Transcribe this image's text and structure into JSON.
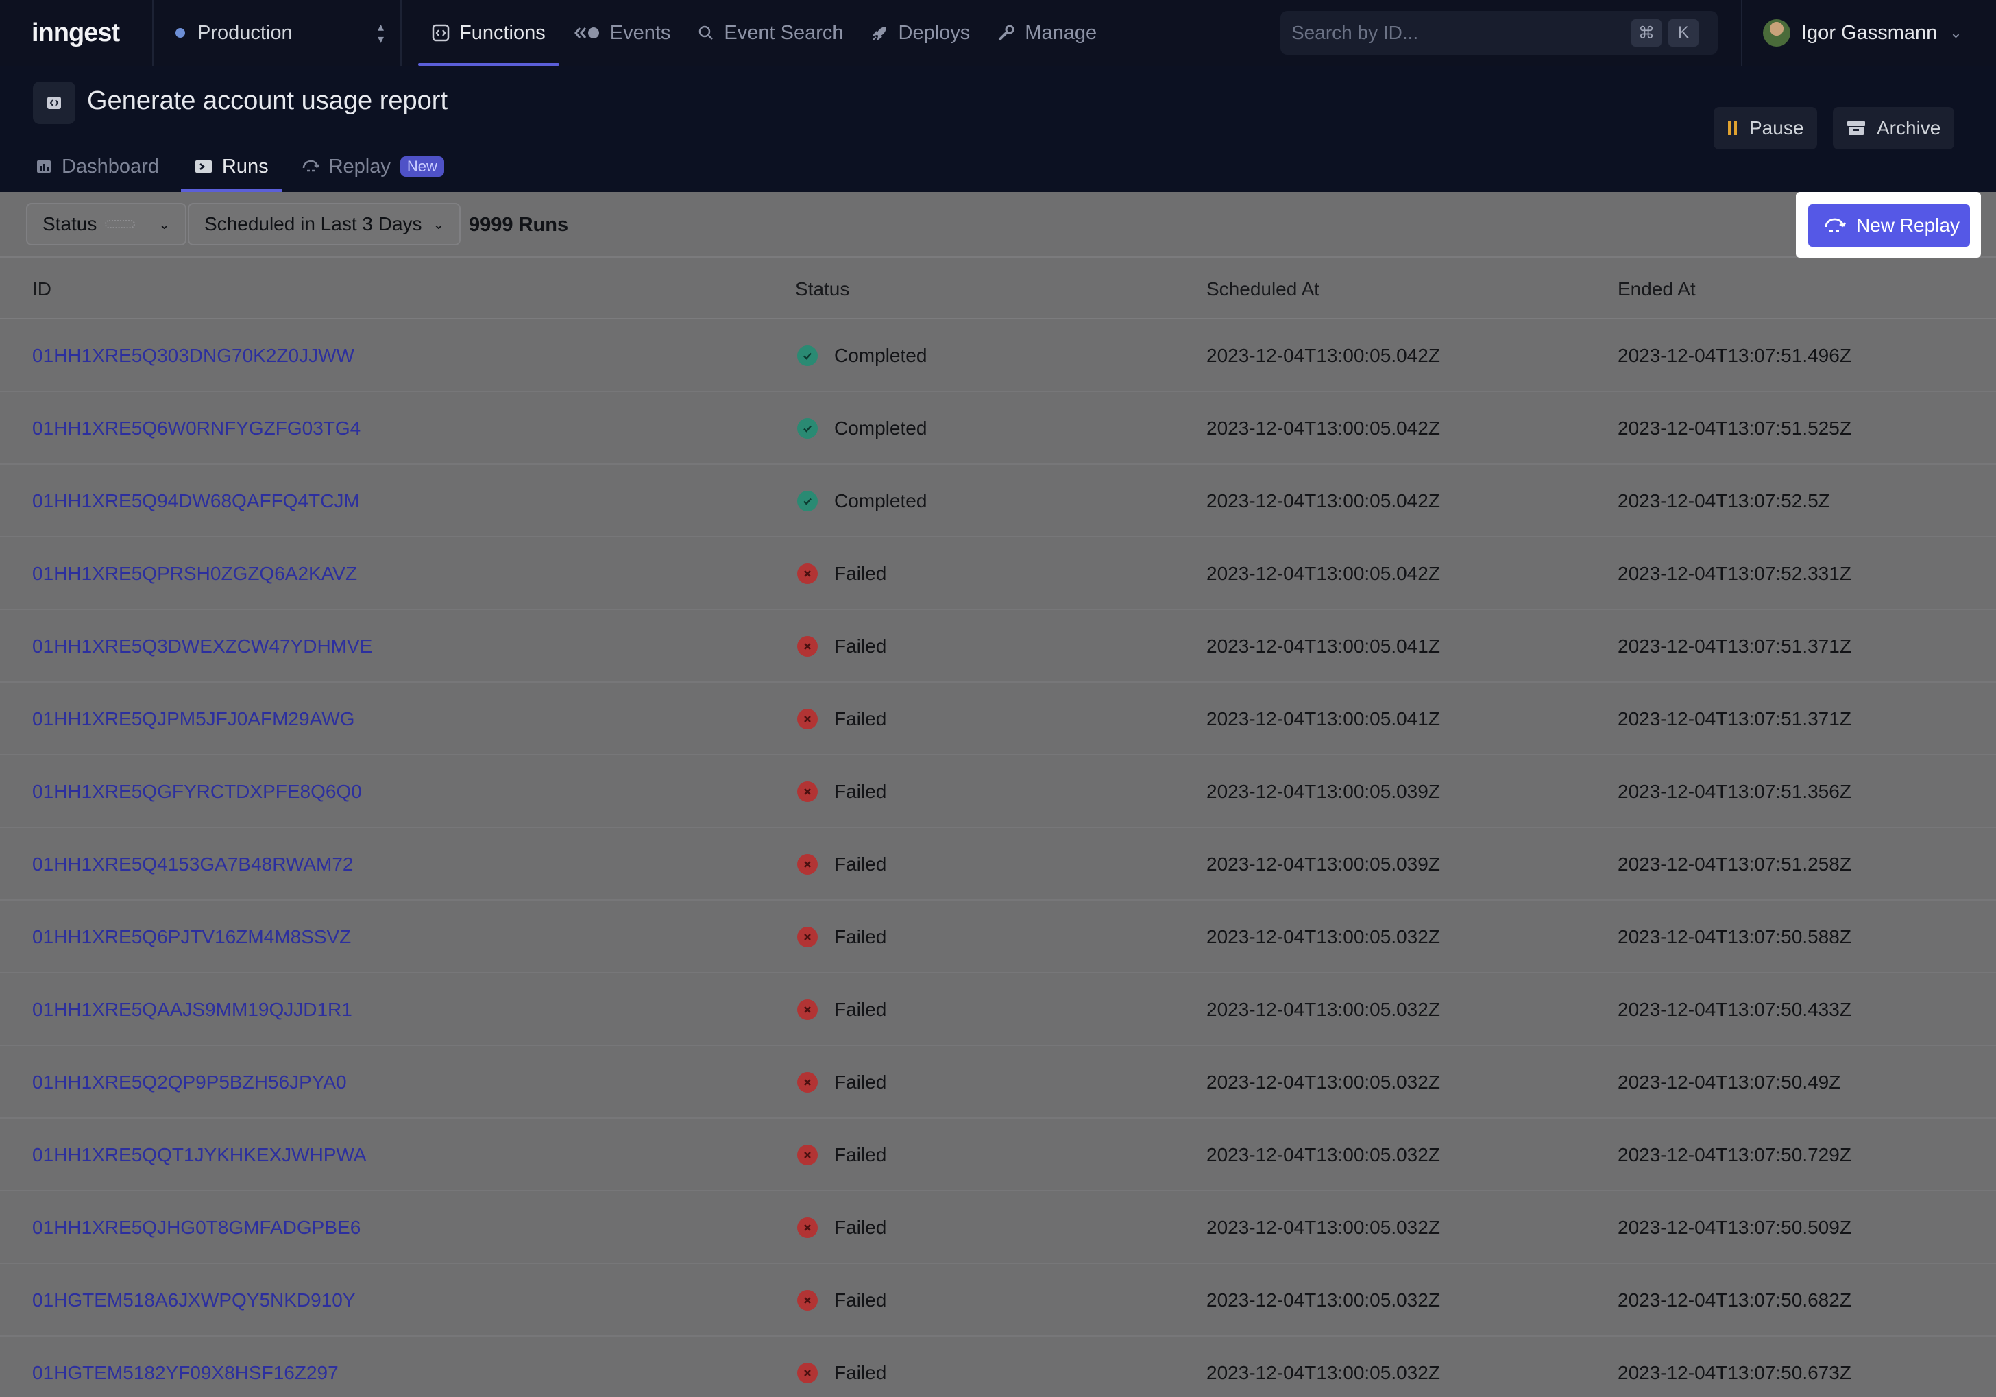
{
  "brand": {
    "logo": "inngest"
  },
  "env": {
    "name": "Production"
  },
  "nav": {
    "items": [
      {
        "label": "Functions",
        "icon": "function-icon",
        "active": true
      },
      {
        "label": "Events",
        "icon": "events-icon",
        "active": false
      },
      {
        "label": "Event Search",
        "icon": "search-icon",
        "active": false
      },
      {
        "label": "Deploys",
        "icon": "rocket-icon",
        "active": false
      },
      {
        "label": "Manage",
        "icon": "wrench-icon",
        "active": false
      }
    ]
  },
  "search": {
    "placeholder": "Search by ID...",
    "shortcut_mod": "⌘",
    "shortcut_key": "K"
  },
  "user": {
    "name": "Igor Gassmann"
  },
  "function": {
    "title": "Generate account usage report"
  },
  "actions": {
    "pause_label": "Pause",
    "archive_label": "Archive"
  },
  "tabs": [
    {
      "label": "Dashboard",
      "icon": "dashboard-icon",
      "active": false
    },
    {
      "label": "Runs",
      "icon": "runs-icon",
      "active": true
    },
    {
      "label": "Replay",
      "icon": "replay-icon",
      "active": false,
      "badge": "New"
    }
  ],
  "filters": {
    "status_label": "Status",
    "time_label": "Scheduled in Last 3 Days",
    "runs_count": "9999 Runs"
  },
  "new_replay": {
    "label": "New Replay"
  },
  "table": {
    "columns": [
      "ID",
      "Status",
      "Scheduled At",
      "Ended At"
    ],
    "rows": [
      {
        "id": "01HH1XRE5Q303DNG70K2Z0JJWW",
        "status": "Completed",
        "scheduled": "2023-12-04T13:00:05.042Z",
        "ended": "2023-12-04T13:07:51.496Z"
      },
      {
        "id": "01HH1XRE5Q6W0RNFYGZFG03TG4",
        "status": "Completed",
        "scheduled": "2023-12-04T13:00:05.042Z",
        "ended": "2023-12-04T13:07:51.525Z"
      },
      {
        "id": "01HH1XRE5Q94DW68QAFFQ4TCJM",
        "status": "Completed",
        "scheduled": "2023-12-04T13:00:05.042Z",
        "ended": "2023-12-04T13:07:52.5Z"
      },
      {
        "id": "01HH1XRE5QPRSH0ZGZQ6A2KAVZ",
        "status": "Failed",
        "scheduled": "2023-12-04T13:00:05.042Z",
        "ended": "2023-12-04T13:07:52.331Z"
      },
      {
        "id": "01HH1XRE5Q3DWEXZCW47YDHMVE",
        "status": "Failed",
        "scheduled": "2023-12-04T13:00:05.041Z",
        "ended": "2023-12-04T13:07:51.371Z"
      },
      {
        "id": "01HH1XRE5QJPM5JFJ0AFM29AWG",
        "status": "Failed",
        "scheduled": "2023-12-04T13:00:05.041Z",
        "ended": "2023-12-04T13:07:51.371Z"
      },
      {
        "id": "01HH1XRE5QGFYRCTDXPFE8Q6Q0",
        "status": "Failed",
        "scheduled": "2023-12-04T13:00:05.039Z",
        "ended": "2023-12-04T13:07:51.356Z"
      },
      {
        "id": "01HH1XRE5Q4153GA7B48RWAM72",
        "status": "Failed",
        "scheduled": "2023-12-04T13:00:05.039Z",
        "ended": "2023-12-04T13:07:51.258Z"
      },
      {
        "id": "01HH1XRE5Q6PJTV16ZM4M8SSVZ",
        "status": "Failed",
        "scheduled": "2023-12-04T13:00:05.032Z",
        "ended": "2023-12-04T13:07:50.588Z"
      },
      {
        "id": "01HH1XRE5QAAJS9MM19QJJD1R1",
        "status": "Failed",
        "scheduled": "2023-12-04T13:00:05.032Z",
        "ended": "2023-12-04T13:07:50.433Z"
      },
      {
        "id": "01HH1XRE5Q2QP9P5BZH56JPYA0",
        "status": "Failed",
        "scheduled": "2023-12-04T13:00:05.032Z",
        "ended": "2023-12-04T13:07:50.49Z"
      },
      {
        "id": "01HH1XRE5QQT1JYKHKEXJWHPWA",
        "status": "Failed",
        "scheduled": "2023-12-04T13:00:05.032Z",
        "ended": "2023-12-04T13:07:50.729Z"
      },
      {
        "id": "01HH1XRE5QJHG0T8GMFADGPBE6",
        "status": "Failed",
        "scheduled": "2023-12-04T13:00:05.032Z",
        "ended": "2023-12-04T13:07:50.509Z"
      },
      {
        "id": "01HGTEM518A6JXWPQY5NKD910Y",
        "status": "Failed",
        "scheduled": "2023-12-04T13:00:05.032Z",
        "ended": "2023-12-04T13:07:50.682Z"
      },
      {
        "id": "01HGTEM5182YF09X8HSF16Z297",
        "status": "Failed",
        "scheduled": "2023-12-04T13:00:05.032Z",
        "ended": "2023-12-04T13:07:50.673Z"
      }
    ]
  },
  "colors": {
    "accent": "#5558e6",
    "success": "#2a8a73",
    "danger": "#b23434",
    "link": "#2c2f9e",
    "nav_bg": "#0d1120"
  }
}
